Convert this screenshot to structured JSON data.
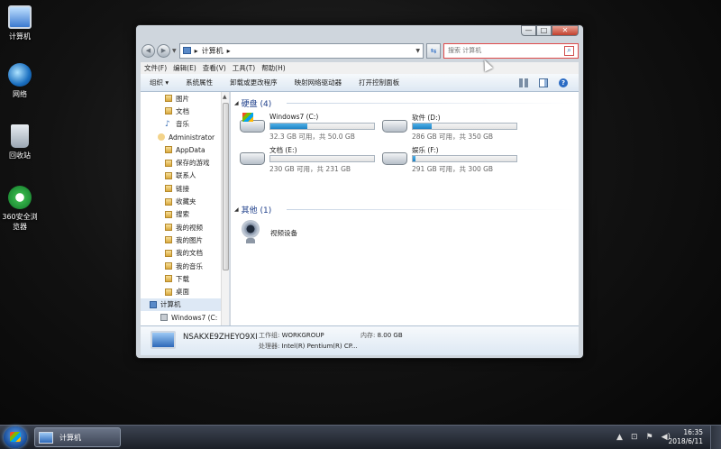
{
  "desktop": {
    "icons": [
      {
        "label": "计算机",
        "icon": "computer-icon"
      },
      {
        "label": "网络",
        "icon": "network-icon"
      },
      {
        "label": "回收站",
        "icon": "recycle-bin-icon"
      },
      {
        "label": "360安全浏览器",
        "icon": "browser-360-icon"
      }
    ]
  },
  "window": {
    "controls": {
      "minimize": "—",
      "maximize": "□",
      "close": "✕"
    },
    "address": {
      "root_crumb": "计算机",
      "separator": "▸"
    },
    "search": {
      "placeholder": "搜索 计算机"
    },
    "menu": [
      "文件(F)",
      "编辑(E)",
      "查看(V)",
      "工具(T)",
      "帮助(H)"
    ],
    "toolbar": {
      "organize": "组织 ▾",
      "system_properties": "系统属性",
      "uninstall": "卸载或更改程序",
      "map_drive": "映射网络驱动器",
      "control_panel": "打开控制面板"
    },
    "nav_pane": {
      "items": [
        {
          "label": "图片",
          "icon": "folder"
        },
        {
          "label": "文档",
          "icon": "folder"
        },
        {
          "label": "音乐",
          "icon": "music"
        },
        {
          "label": "Administrator",
          "icon": "user"
        },
        {
          "label": "AppData",
          "icon": "folder"
        },
        {
          "label": "保存的游戏",
          "icon": "folder"
        },
        {
          "label": "联系人",
          "icon": "folder"
        },
        {
          "label": "链接",
          "icon": "folder"
        },
        {
          "label": "收藏夹",
          "icon": "folder"
        },
        {
          "label": "搜索",
          "icon": "folder"
        },
        {
          "label": "我的视频",
          "icon": "folder"
        },
        {
          "label": "我的图片",
          "icon": "folder"
        },
        {
          "label": "我的文档",
          "icon": "folder"
        },
        {
          "label": "我的音乐",
          "icon": "folder"
        },
        {
          "label": "下载",
          "icon": "folder"
        },
        {
          "label": "桌面",
          "icon": "folder"
        },
        {
          "label": "计算机",
          "icon": "computer"
        },
        {
          "label": "Windows7 (C:",
          "icon": "drive"
        }
      ]
    },
    "content": {
      "hard_disks_header": "硬盘 (4)",
      "drives": [
        {
          "name": "Windows7 (C:)",
          "info": "32.3 GB 可用，共 50.0 GB",
          "used_fraction": 0.354
        },
        {
          "name": "软件 (D:)",
          "info": "286 GB 可用，共 350 GB",
          "used_fraction": 0.183
        },
        {
          "name": "文档 (E:)",
          "info": "230 GB 可用，共 231 GB",
          "used_fraction": 0.004
        },
        {
          "name": "娱乐 (F:)",
          "info": "291 GB 可用，共 300 GB",
          "used_fraction": 0.03
        }
      ],
      "other_header": "其他 (1)",
      "other_items": [
        {
          "name": "视频设备"
        }
      ]
    },
    "details": {
      "computer_name": "NSAKXE9ZHEYO9XI",
      "workgroup_label": "工作组:",
      "workgroup": "WORKGROUP",
      "memory_label": "内存:",
      "memory": "8.00 GB",
      "cpu_label": "处理器:",
      "cpu": "Intel(R) Pentium(R) CP..."
    }
  },
  "taskbar": {
    "task_label": "计算机",
    "time": "16:35",
    "date": "2018/6/11"
  }
}
